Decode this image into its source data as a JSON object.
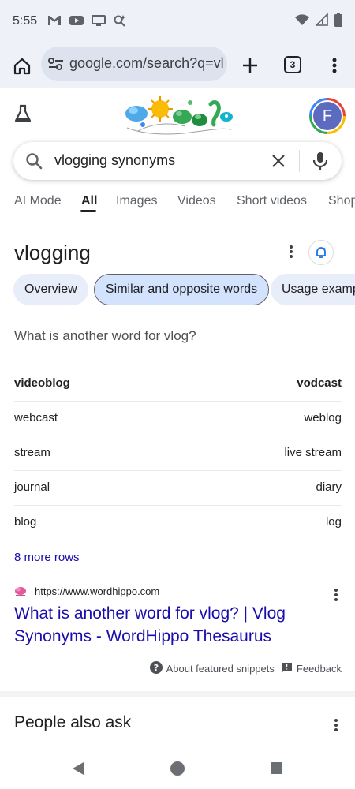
{
  "status_bar": {
    "time": "5:55",
    "left_icons": [
      "gmail-icon",
      "youtube-icon",
      "cast-icon",
      "assistant-icon"
    ],
    "right_icons": [
      "wifi-icon",
      "signal-icon",
      "battery-icon"
    ]
  },
  "browser": {
    "url": "google.com/search?q=vl",
    "tab_count": "3"
  },
  "search": {
    "query": "vlogging synonyms"
  },
  "tabs": [
    {
      "label": "AI Mode"
    },
    {
      "label": "All",
      "active": true
    },
    {
      "label": "Images"
    },
    {
      "label": "Videos"
    },
    {
      "label": "Short videos"
    },
    {
      "label": "Shop"
    }
  ],
  "avatar": {
    "initial": "F"
  },
  "heading": {
    "title": "vlogging"
  },
  "chips": [
    {
      "label": "Overview"
    },
    {
      "label": "Similar and opposite words",
      "selected": true
    },
    {
      "label": "Usage examples"
    }
  ],
  "synonyms": {
    "question": "What is another word for vlog?",
    "rows": [
      {
        "left": "videoblog",
        "right": "vodcast"
      },
      {
        "left": "webcast",
        "right": "weblog"
      },
      {
        "left": "stream",
        "right": "live stream"
      },
      {
        "left": "journal",
        "right": "diary"
      },
      {
        "left": "blog",
        "right": "log"
      }
    ],
    "more_rows": "8 more rows"
  },
  "result": {
    "source_url": "https://www.wordhippo.com",
    "title": "What is another word for vlog? | Vlog Synonyms - WordHippo Thesaurus"
  },
  "snippet_footer": {
    "about": "About featured snippets",
    "feedback": "Feedback"
  },
  "people_also_ask": {
    "title": "People also ask"
  },
  "colors": {
    "link": "#1a0dab",
    "chip_bg": "#e8eef9",
    "chip_selected_bg": "#d3e3fd",
    "toolbar_bg": "#eef1f8"
  }
}
